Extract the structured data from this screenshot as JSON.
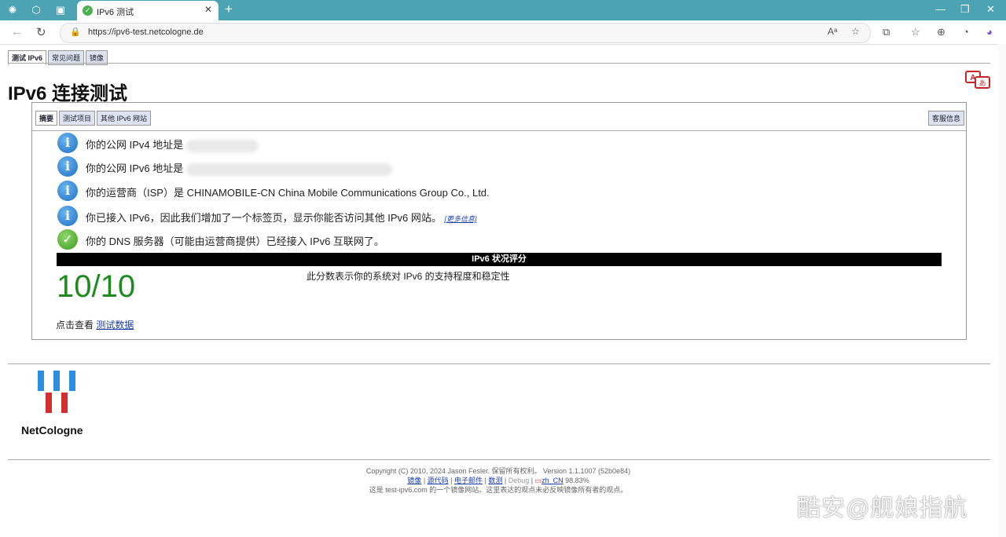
{
  "browser": {
    "tab_title": "IPv6 测试",
    "url": "https://ipv6-test.netcologne.de"
  },
  "page_tabs": [
    "测试 IPv6",
    "常见问题",
    "镜像"
  ],
  "title": "IPv6 连接测试",
  "inner_tabs": [
    "摘要",
    "测试项目",
    "其他 IPv6 网站"
  ],
  "support_tab": "客服信息",
  "results": [
    {
      "icon": "info-icon",
      "text": "你的公网 IPv4 地址是 "
    },
    {
      "icon": "info-icon",
      "text": "你的公网 IPv6 地址是 "
    },
    {
      "icon": "info-icon",
      "text": "你的运营商（ISP）是 CHINAMOBILE-CN China Mobile Communications Group Co., Ltd."
    },
    {
      "icon": "info-icon",
      "text": "你已接入 IPv6，因此我们增加了一个标签页，显示你能否访问其他 IPv6 网站。",
      "link": "[更多信息]"
    },
    {
      "icon": "check-icon",
      "text": "你的 DNS 服务器（可能由运营商提供）已经接入 IPv6 互联网了。"
    }
  ],
  "score": {
    "header": "IPv6 状况评分",
    "value": "10/10",
    "description": "此分数表示你的系统对 IPv6 的支持程度和稳定性",
    "see_prefix": "点击查看 ",
    "see_link": "测试数据"
  },
  "logo_text": "NetCologne",
  "footer": {
    "copyright": "Copyright (C) 2010, 2024 Jason Fesler. 保留所有权利。 Version 1.1.1007 (52b0e84)",
    "links": [
      "镜像",
      "源代码",
      "电子邮件",
      "数测",
      "Debug",
      "zh_CN"
    ],
    "locale_pct": "98.83%",
    "disclaimer": "这是 test-ipv6.com 的一个镜像网站。这里表达的观点未必反映镜像所有者的观点。"
  },
  "watermark": "酷安@舰娘指航",
  "colors": {
    "score": "#1f8a1f",
    "tabbar": "#4ba3b4",
    "link": "#1a3fa8"
  }
}
